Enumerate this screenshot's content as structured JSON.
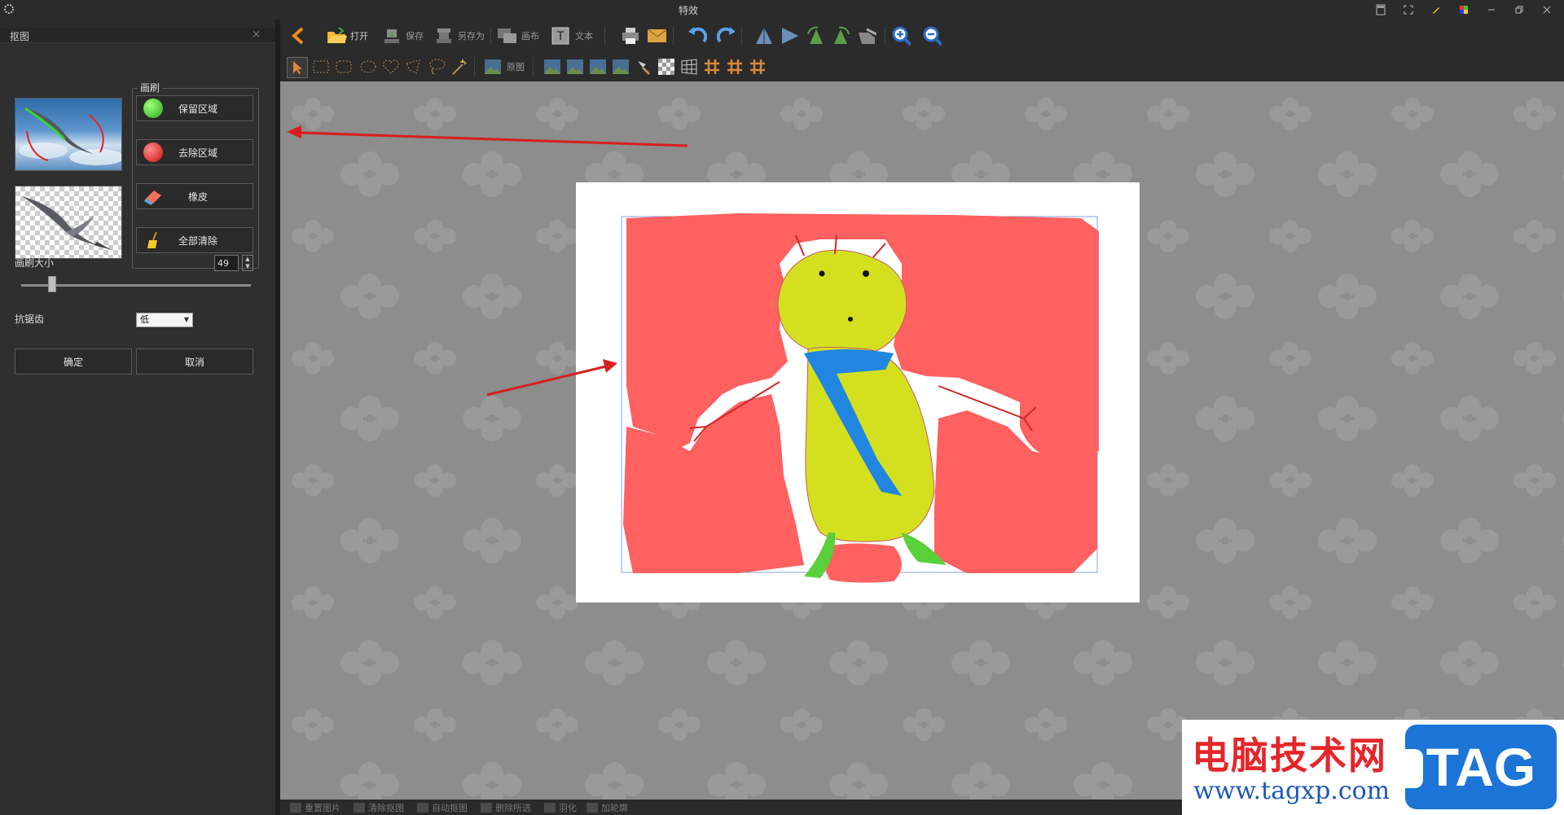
{
  "window": {
    "title": "特效"
  },
  "left_panel": {
    "header": "抠图",
    "close_glyph": "×",
    "brush": {
      "legend": "画刷",
      "keep_label": "保留区域",
      "remove_label": "去除区域",
      "eraser_label": "橡皮",
      "clear_label": "全部清除"
    },
    "brush_size_label": "画刷大小",
    "brush_size_value": "49",
    "brush_size_level": 0.12,
    "antialias_label": "抗锯齿",
    "antialias_value": "低",
    "ok_label": "确定",
    "cancel_label": "取消"
  },
  "toolbar": {
    "open": "打开",
    "save": "保存",
    "save_as": "另存为",
    "canvas": "画布",
    "text": "文本",
    "text_glyph": "T",
    "original": "原图"
  },
  "statusbar": {
    "items": [
      "重置图片",
      "清除抠图",
      "自动抠图",
      "删除所选",
      "羽化",
      "加轮廓"
    ]
  },
  "watermark": {
    "text": "电脑技术网",
    "url": "www.tagxp.com",
    "tag": "TAG"
  },
  "colors": {
    "keep_green": "#3bbf2a",
    "remove_red": "#e02424",
    "mask_red": "#ff6060",
    "figure_yellow": "#d4e01f",
    "scarf_blue": "#2086e0",
    "arrow_red": "#d81e1e",
    "accent_orange": "#f08a1c"
  }
}
